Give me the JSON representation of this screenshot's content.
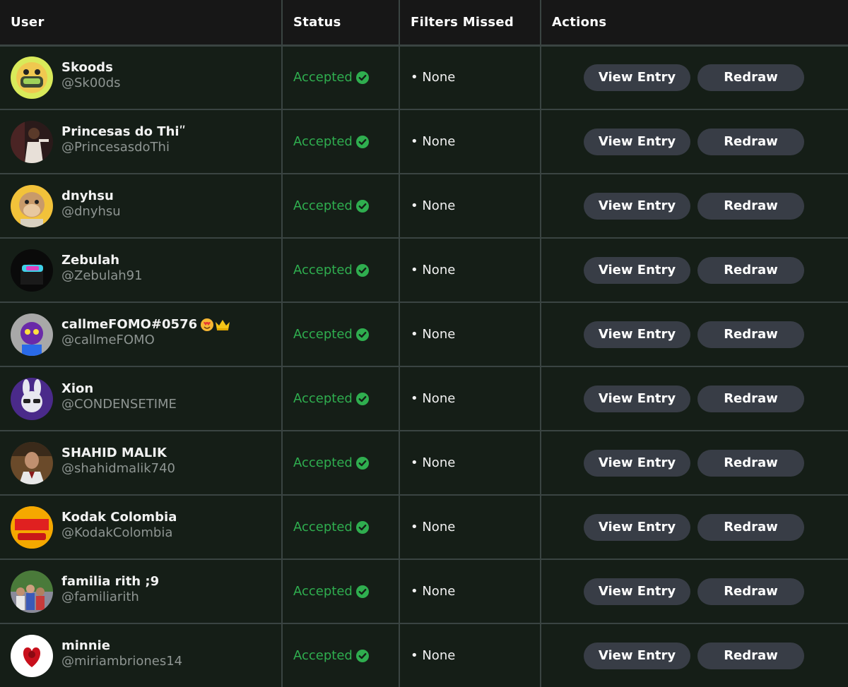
{
  "header": {
    "user": "User",
    "status": "Status",
    "filters_missed": "Filters Missed",
    "actions": "Actions"
  },
  "buttons": {
    "view_entry": "View Entry",
    "redraw": "Redraw"
  },
  "colors": {
    "accepted": "#2fae4f",
    "button_bg": "#383d46",
    "row_bg": "#151e17",
    "header_bg": "#171717",
    "border": "#3a4442"
  },
  "rows": [
    {
      "name": "Skoods",
      "handle": "@Sk00ds",
      "status": "Accepted",
      "filters": "• None",
      "avatar": "monkey-avatar-icon"
    },
    {
      "name": "Princesas do Thiʺ",
      "handle": "@PrincesasdoThi",
      "status": "Accepted",
      "filters": "• None",
      "avatar": "person-avatar-icon"
    },
    {
      "name": "dnyhsu",
      "handle": "@dnyhsu",
      "status": "Accepted",
      "filters": "• None",
      "avatar": "ape-avatar-icon"
    },
    {
      "name": "Zebulah",
      "handle": "@Zebulah91",
      "status": "Accepted",
      "filters": "• None",
      "avatar": "vr-avatar-icon"
    },
    {
      "name": "callmeFOMO#0576",
      "handle": "@callmeFOMO",
      "status": "Accepted",
      "filters": "• None",
      "avatar": "purple-creature-avatar-icon"
    },
    {
      "name": "Xion",
      "handle": "@CONDENSETIME",
      "status": "Accepted",
      "filters": "• None",
      "avatar": "bunny-avatar-icon"
    },
    {
      "name": "SHAHID MALIK",
      "handle": "@shahidmalik740",
      "status": "Accepted",
      "filters": "• None",
      "avatar": "man-photo-avatar-icon"
    },
    {
      "name": "Kodak Colombia",
      "handle": "@KodakColombia",
      "status": "Accepted",
      "filters": "• None",
      "avatar": "kodak-logo-avatar-icon"
    },
    {
      "name": "familia rith ;9",
      "handle": "@familiarith",
      "status": "Accepted",
      "filters": "• None",
      "avatar": "group-photo-avatar-icon"
    },
    {
      "name": "minnie",
      "handle": "@miriambriones14",
      "status": "Accepted",
      "filters": "• None",
      "avatar": "rose-heart-avatar-icon"
    }
  ]
}
